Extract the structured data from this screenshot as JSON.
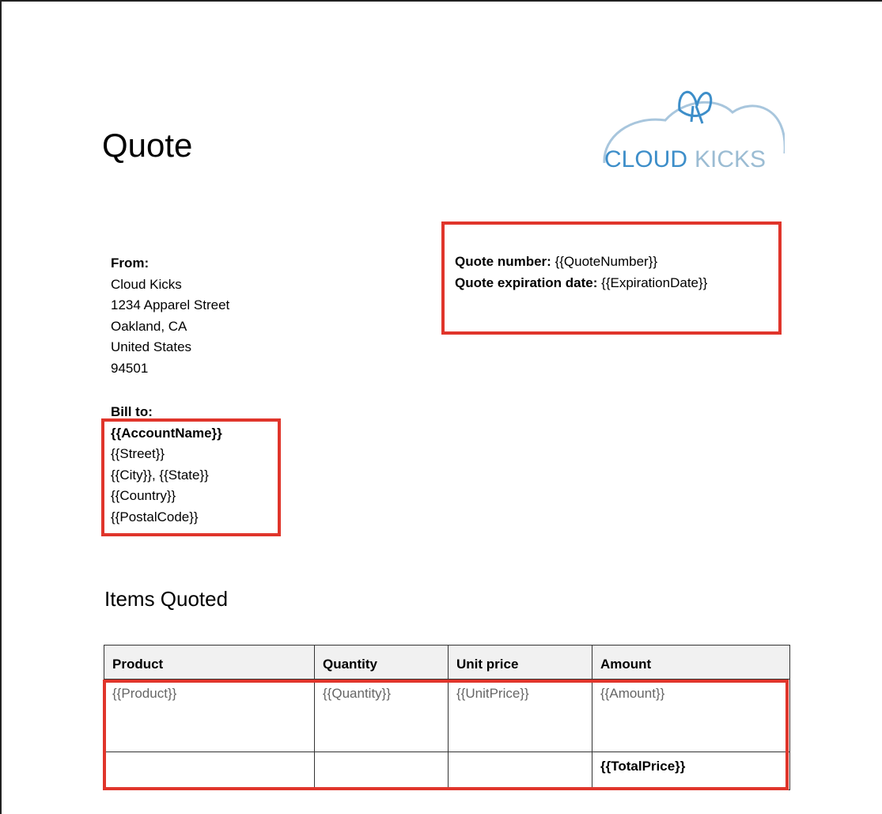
{
  "doc": {
    "title": "Quote"
  },
  "logo": {
    "text_left": "CLOUD",
    "text_right": "KICKS",
    "color_main": "#7aa9cc",
    "color_accent": "#3d8ec9"
  },
  "from": {
    "label": "From:",
    "lines": [
      "Cloud Kicks",
      "1234 Apparel Street",
      "Oakland, CA",
      "United States",
      "94501"
    ]
  },
  "quote_info": {
    "number_label": "Quote number:",
    "number_value": " {{QuoteNumber}}",
    "expiry_label": "Quote expiration date:",
    "expiry_value": " {{ExpirationDate}}"
  },
  "bill_to": {
    "label": "Bill to:",
    "account": "{{AccountName}}",
    "lines": [
      "{{Street}}",
      "{{City}}, {{State}}",
      "{{Country}}",
      "{{PostalCode}}"
    ]
  },
  "items": {
    "heading": "Items Quoted",
    "headers": [
      "Product",
      "Quantity",
      "Unit price",
      "Amount"
    ],
    "row": [
      "{{Product}}",
      "{{Quantity}}",
      "{{UnitPrice}}",
      "{{Amount}}"
    ],
    "total": "{{TotalPrice}}"
  },
  "highlight_color": "#e0352b"
}
